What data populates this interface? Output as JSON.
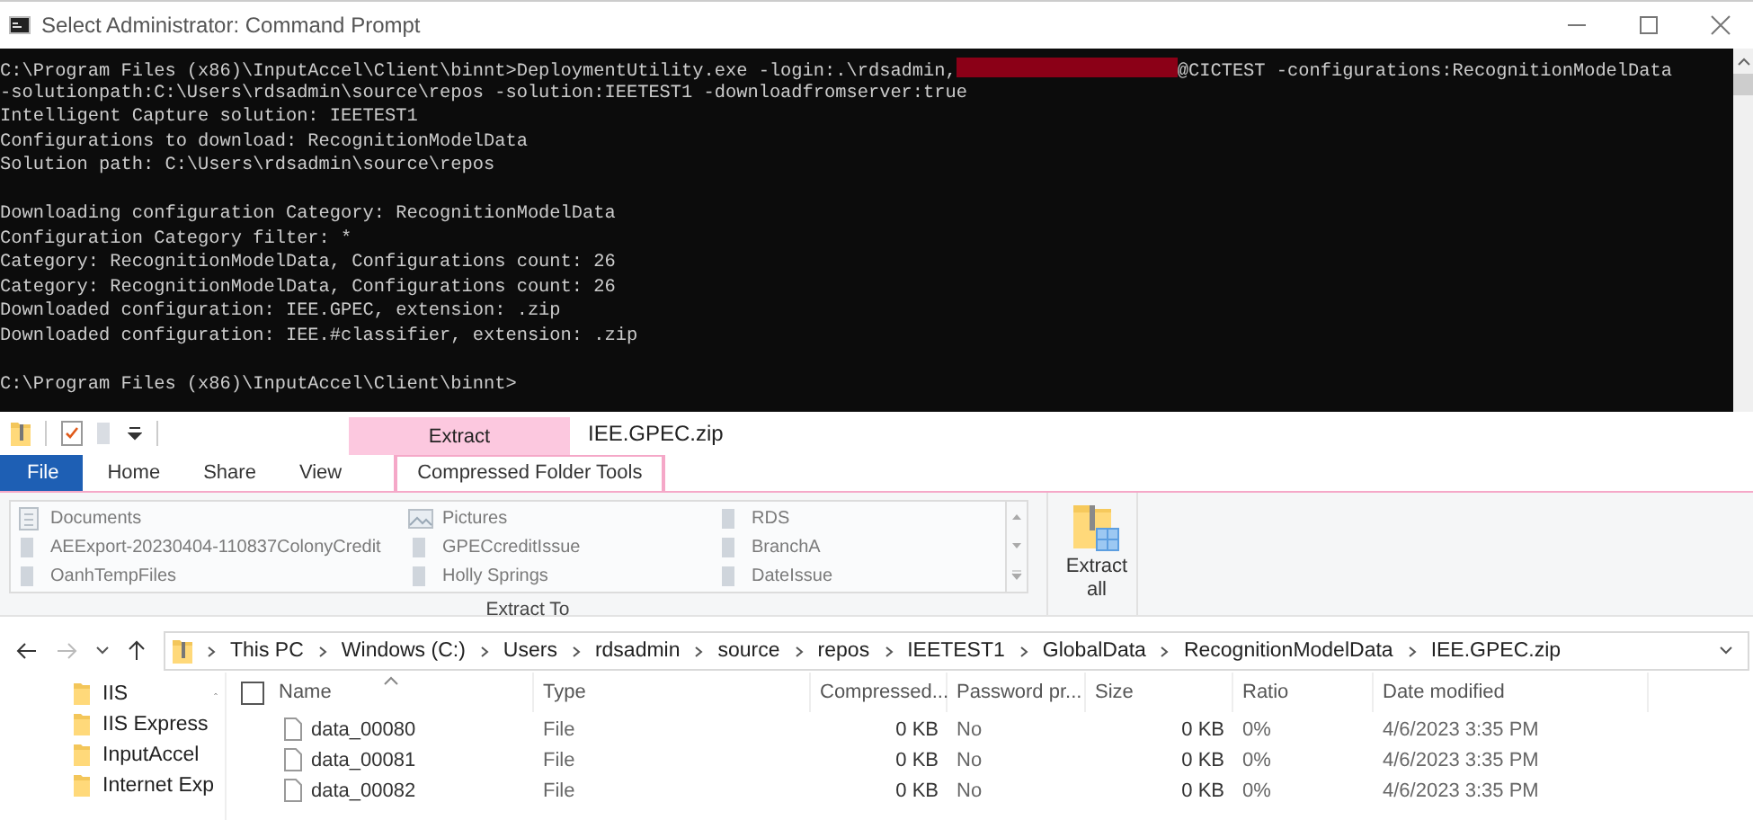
{
  "console": {
    "title": "Select Administrator: Command Prompt",
    "lines": [
      {
        "kind": "redacted",
        "before": "C:\\Program Files (x86)\\InputAccel\\Client\\binnt>DeploymentUtility.exe -login:.\\rdsadmin,",
        "after": "@CICTEST -configurations:RecognitionModelData"
      },
      {
        "kind": "text",
        "text": "-solutionpath:C:\\Users\\rdsadmin\\source\\repos -solution:IEETEST1 -downloadfromserver:true"
      },
      {
        "kind": "text",
        "text": "Intelligent Capture solution: IEETEST1"
      },
      {
        "kind": "text",
        "text": "Configurations to download: RecognitionModelData"
      },
      {
        "kind": "text",
        "text": "Solution path: C:\\Users\\rdsadmin\\source\\repos"
      },
      {
        "kind": "blank"
      },
      {
        "kind": "text",
        "text": "Downloading configuration Category: RecognitionModelData"
      },
      {
        "kind": "text",
        "text": "Configuration Category filter: *"
      },
      {
        "kind": "text",
        "text": "Category: RecognitionModelData, Configurations count: 26"
      },
      {
        "kind": "text",
        "text": "Category: RecognitionModelData, Configurations count: 26"
      },
      {
        "kind": "text",
        "text": "Downloaded configuration: IEE.GPEC, extension: .zip"
      },
      {
        "kind": "text",
        "text": "Downloaded configuration: IEE.#classifier, extension: .zip"
      },
      {
        "kind": "blank"
      },
      {
        "kind": "text",
        "text": "C:\\Program Files (x86)\\InputAccel\\Client\\binnt>"
      }
    ]
  },
  "explorer": {
    "context_tab_group": "Extract",
    "title": "IEE.GPEC.zip",
    "tabs": [
      {
        "label": "File",
        "kind": "file",
        "selected": false
      },
      {
        "label": "Home",
        "kind": "plain",
        "selected": false
      },
      {
        "label": "Share",
        "kind": "plain",
        "selected": false
      },
      {
        "label": "View",
        "kind": "plain",
        "selected": false
      },
      {
        "label": "Compressed Folder Tools",
        "kind": "context",
        "selected": true
      }
    ],
    "extract_to": {
      "label": "Extract To",
      "locations": [
        {
          "label": "Documents",
          "kind": "documents"
        },
        {
          "label": "Pictures",
          "kind": "pictures"
        },
        {
          "label": "RDS",
          "kind": "folder"
        },
        {
          "label": "AEExport-20230404-110837ColonyCredit",
          "kind": "folder"
        },
        {
          "label": "GPECcreditIssue",
          "kind": "folder"
        },
        {
          "label": "BranchA",
          "kind": "folder"
        },
        {
          "label": "OanhTempFiles",
          "kind": "folder"
        },
        {
          "label": "Holly Springs",
          "kind": "folder"
        },
        {
          "label": "DateIssue",
          "kind": "folder"
        }
      ]
    },
    "extract_all_button": "Extract\nall",
    "address": [
      "This PC",
      "Windows (C:)",
      "Users",
      "rdsadmin",
      "source",
      "repos",
      "IEETEST1",
      "GlobalData",
      "RecognitionModelData",
      "IEE.GPEC.zip"
    ],
    "nav_pane": [
      "IIS",
      "IIS Express",
      "InputAccel",
      "Internet Exp"
    ],
    "table": {
      "select_all_checked": false,
      "columns": [
        "Name",
        "Type",
        "Compressed...",
        "Password pr...",
        "Size",
        "Ratio",
        "Date modified"
      ],
      "rows": [
        [
          "data_00080",
          "File",
          "0 KB",
          "No",
          "0 KB",
          "0%",
          "4/6/2023 3:35 PM"
        ],
        [
          "data_00081",
          "File",
          "0 KB",
          "No",
          "0 KB",
          "0%",
          "4/6/2023 3:35 PM"
        ],
        [
          "data_00082",
          "File",
          "0 KB",
          "No",
          "0 KB",
          "0%",
          "4/6/2023 3:35 PM"
        ]
      ]
    }
  }
}
